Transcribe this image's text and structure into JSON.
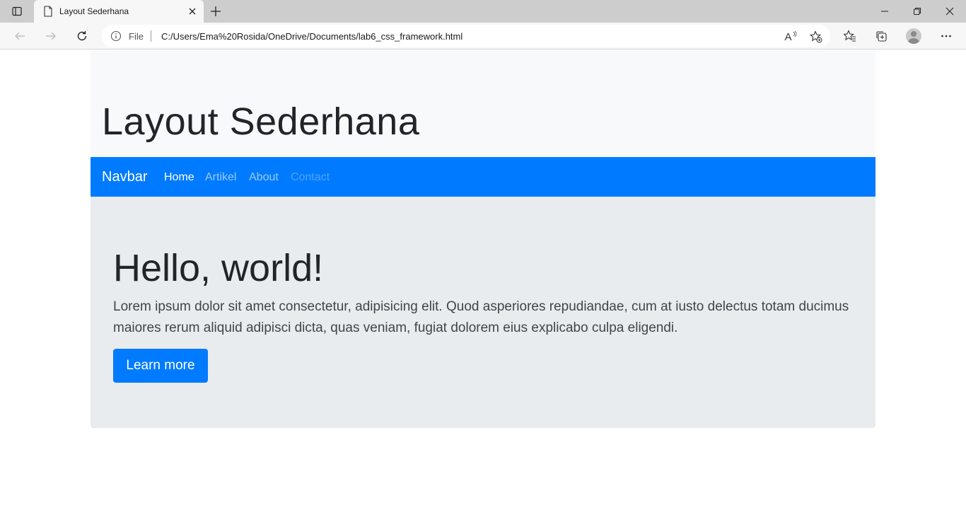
{
  "browser": {
    "tab_title": "Layout Sederhana",
    "address_scheme": "File",
    "address_url": "C:/Users/Ema%20Rosida/OneDrive/Documents/lab6_css_framework.html",
    "read_aloud_label": "A",
    "icons": [
      "tab-actions-icon",
      "page-icon",
      "close-icon",
      "plus-icon",
      "minimize-icon",
      "restore-icon",
      "window-close-icon",
      "back-icon",
      "forward-icon",
      "reload-icon",
      "info-icon",
      "read-aloud-icon",
      "add-favorite-icon",
      "favorites-icon",
      "collections-icon",
      "profile-avatar",
      "more-icon"
    ]
  },
  "page": {
    "header_title": "Layout Sederhana",
    "navbar": {
      "brand": "Navbar",
      "links": [
        "Home",
        "Artikel",
        "About",
        "Contact"
      ]
    },
    "jumbotron": {
      "heading": "Hello, world!",
      "lead": "Lorem ipsum dolor sit amet consectetur, adipisicing elit. Quod asperiores repudiandae, cum at iusto delectus totam ducimus maiores rerum aliquid adipisci dicta, quas veniam, fugiat dolorem eius explicabo culpa eligendi.",
      "button_label": "Learn more"
    },
    "colors": {
      "primary": "#007bff",
      "header_bg": "#f8f9fa",
      "jumbotron_bg": "#e9ecef",
      "text": "#212529"
    }
  }
}
